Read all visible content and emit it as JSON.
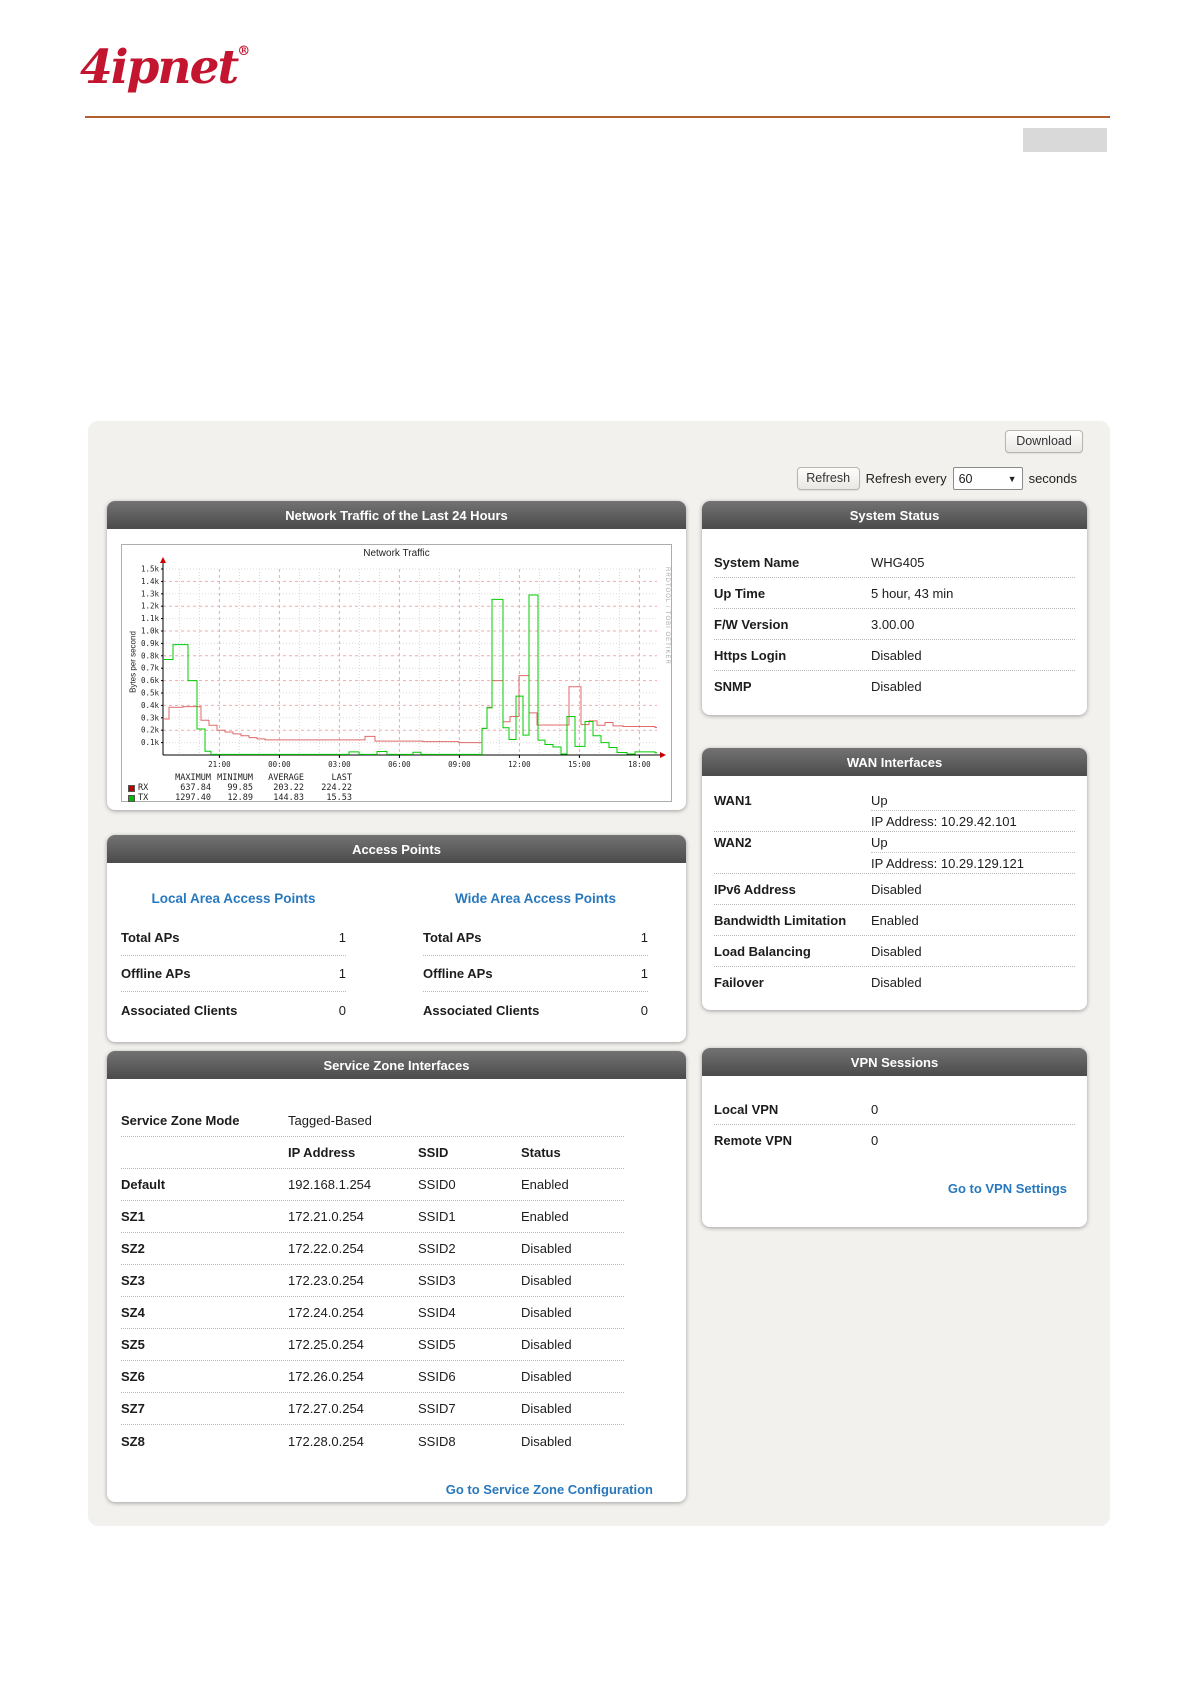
{
  "brand": {
    "logo_text": "4ipnet",
    "registered_mark": "®",
    "logo_color": "#c41530",
    "rule_color": "#b25f2e"
  },
  "toolbar": {
    "download_label": "Download",
    "refresh_button_label": "Refresh",
    "refresh_every_label": "Refresh every",
    "refresh_interval_value": "60",
    "seconds_label": "seconds",
    "dropdown_arrow": "▼"
  },
  "colors": {
    "accent_blue": "#2878bd",
    "panel_header_dark": "#4b4b4b",
    "surface": "#f3f1ee"
  },
  "panels": {
    "network_traffic": {
      "title": "Network Traffic of the Last 24 Hours"
    },
    "system_status": {
      "title": "System Status",
      "rows": [
        {
          "label": "System Name",
          "value": "WHG405"
        },
        {
          "label": "Up Time",
          "value": "5 hour, 43 min"
        },
        {
          "label": "F/W Version",
          "value": "3.00.00"
        },
        {
          "label": "Https Login",
          "value": "Disabled"
        },
        {
          "label": "SNMP",
          "value": "Disabled"
        }
      ]
    },
    "wan_interfaces": {
      "title": "WAN Interfaces",
      "rows": [
        {
          "label": "WAN1",
          "value": "Up",
          "detail": "IP Address: 10.29.42.101"
        },
        {
          "label": "WAN2",
          "value": "Up",
          "detail": "IP Address: 10.29.129.121"
        },
        {
          "label": "IPv6 Address",
          "value": "Disabled"
        },
        {
          "label": "Bandwidth Limitation",
          "value": "Enabled"
        },
        {
          "label": "Load Balancing",
          "value": "Disabled"
        },
        {
          "label": "Failover",
          "value": "Disabled"
        }
      ]
    },
    "access_points": {
      "title": "Access Points",
      "groups": [
        {
          "heading": "Local Area Access Points",
          "rows": [
            [
              "Total APs",
              "1"
            ],
            [
              "Offline APs",
              "1"
            ],
            [
              "Associated Clients",
              "0"
            ]
          ]
        },
        {
          "heading": "Wide Area Access Points",
          "rows": [
            [
              "Total APs",
              "1"
            ],
            [
              "Offline APs",
              "1"
            ],
            [
              "Associated Clients",
              "0"
            ]
          ]
        }
      ]
    },
    "service_zone": {
      "title": "Service Zone Interfaces",
      "mode_label": "Service Zone Mode",
      "mode_value": "Tagged-Based",
      "columns": [
        "IP Address",
        "SSID",
        "Status"
      ],
      "rows": [
        [
          "Default",
          "192.168.1.254",
          "SSID0",
          "Enabled"
        ],
        [
          "SZ1",
          "172.21.0.254",
          "SSID1",
          "Enabled"
        ],
        [
          "SZ2",
          "172.22.0.254",
          "SSID2",
          "Disabled"
        ],
        [
          "SZ3",
          "172.23.0.254",
          "SSID3",
          "Disabled"
        ],
        [
          "SZ4",
          "172.24.0.254",
          "SSID4",
          "Disabled"
        ],
        [
          "SZ5",
          "172.25.0.254",
          "SSID5",
          "Disabled"
        ],
        [
          "SZ6",
          "172.26.0.254",
          "SSID6",
          "Disabled"
        ],
        [
          "SZ7",
          "172.27.0.254",
          "SSID7",
          "Disabled"
        ],
        [
          "SZ8",
          "172.28.0.254",
          "SSID8",
          "Disabled"
        ]
      ],
      "link_label": "Go to Service Zone Configuration"
    },
    "vpn_sessions": {
      "title": "VPN Sessions",
      "rows": [
        {
          "label": "Local VPN",
          "value": "0"
        },
        {
          "label": "Remote VPN",
          "value": "0"
        }
      ],
      "link_label": "Go to VPN Settings"
    }
  },
  "chart_data": {
    "type": "line",
    "title": "Network Traffic",
    "ylabel": "Bytes per second",
    "watermark": "RRDTOOL / TOBI OETIKER",
    "grid": true,
    "legend_position": "bottom",
    "x_ticks": [
      "21:00",
      "00:00",
      "03:00",
      "06:00",
      "09:00",
      "12:00",
      "15:00",
      "18:00"
    ],
    "x_tick_hours": [
      2.82,
      5.82,
      8.82,
      11.82,
      14.82,
      17.82,
      20.82,
      23.82
    ],
    "xlim_hours": [
      0,
      24.7
    ],
    "y_ticks": [
      "0.1k",
      "0.2k",
      "0.3k",
      "0.4k",
      "0.5k",
      "0.6k",
      "0.7k",
      "0.8k",
      "0.9k",
      "1.0k",
      "1.1k",
      "1.2k",
      "1.3k",
      "1.4k",
      "1.5k"
    ],
    "ylim": [
      0,
      1500
    ],
    "legend_columns": [
      "MAXIMUM",
      "MINIMUM",
      "AVERAGE",
      "LAST"
    ],
    "series": [
      {
        "name": "RX",
        "color": "#e06a6a",
        "legend_color": "#bb0000",
        "stats": [
          "637.84",
          "99.85",
          "203.22",
          "224.22"
        ],
        "steps": [
          [
            0,
            290
          ],
          [
            0.3,
            385
          ],
          [
            1.0,
            390
          ],
          [
            1.9,
            280
          ],
          [
            2.3,
            240
          ],
          [
            2.7,
            200
          ],
          [
            3.1,
            185
          ],
          [
            3.5,
            170
          ],
          [
            3.9,
            155
          ],
          [
            4.3,
            140
          ],
          [
            4.7,
            130
          ],
          [
            5.1,
            122
          ],
          [
            10.1,
            150
          ],
          [
            10.6,
            112
          ],
          [
            13.0,
            108
          ],
          [
            14.8,
            100
          ],
          [
            15.95,
            215
          ],
          [
            16.2,
            385
          ],
          [
            16.45,
            600
          ],
          [
            17.0,
            268
          ],
          [
            17.35,
            310
          ],
          [
            17.8,
            640
          ],
          [
            18.3,
            340
          ],
          [
            18.7,
            242
          ],
          [
            20.3,
            550
          ],
          [
            20.9,
            245
          ],
          [
            21.3,
            275
          ],
          [
            21.7,
            240
          ],
          [
            22.1,
            262
          ],
          [
            22.5,
            235
          ],
          [
            23.0,
            230
          ],
          [
            24.6,
            222
          ]
        ]
      },
      {
        "name": "TX",
        "color": "#00cc00",
        "legend_color": "#00b800",
        "stats": [
          "1297.40",
          "12.89",
          "144.83",
          "15.53"
        ],
        "steps": [
          [
            0,
            770
          ],
          [
            0.5,
            890
          ],
          [
            1.25,
            600
          ],
          [
            1.7,
            210
          ],
          [
            2.1,
            30
          ],
          [
            2.4,
            5
          ],
          [
            9.3,
            25
          ],
          [
            9.8,
            5
          ],
          [
            10.7,
            28
          ],
          [
            11.2,
            5
          ],
          [
            12.5,
            22
          ],
          [
            12.9,
            5
          ],
          [
            15.95,
            215
          ],
          [
            16.2,
            380
          ],
          [
            16.45,
            1255
          ],
          [
            17.0,
            220
          ],
          [
            17.3,
            125
          ],
          [
            17.65,
            475
          ],
          [
            18.0,
            160
          ],
          [
            18.3,
            1290
          ],
          [
            18.75,
            120
          ],
          [
            19.1,
            85
          ],
          [
            19.5,
            65
          ],
          [
            19.9,
            8
          ],
          [
            20.2,
            310
          ],
          [
            20.6,
            70
          ],
          [
            21.1,
            270
          ],
          [
            21.5,
            155
          ],
          [
            21.9,
            100
          ],
          [
            22.3,
            60
          ],
          [
            22.7,
            20
          ],
          [
            23.2,
            8
          ],
          [
            23.6,
            25
          ],
          [
            24.6,
            18
          ]
        ]
      }
    ]
  }
}
